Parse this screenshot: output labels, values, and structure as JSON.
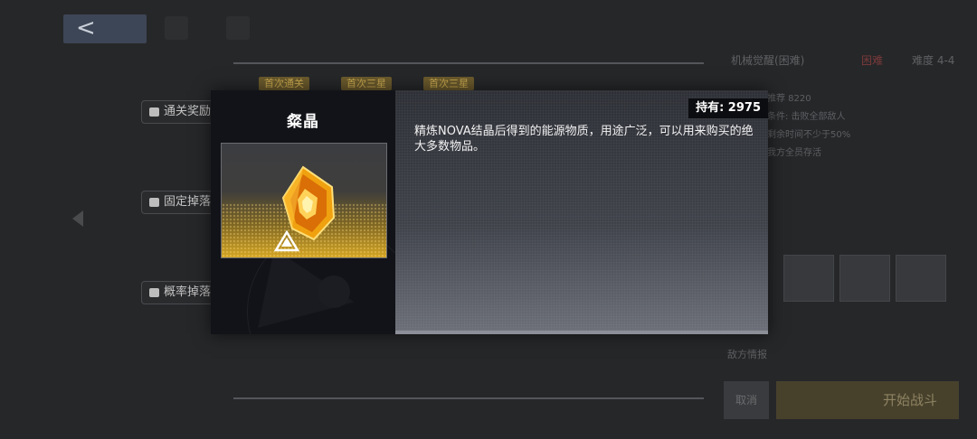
{
  "background": {
    "back_glyph": "<",
    "top_icons": [
      "home-icon",
      "help-icon"
    ],
    "badges": [
      "首次通关",
      "首次三星",
      "首次三星"
    ],
    "side_labels": [
      "通关奖励",
      "固定掉落",
      "概率掉落"
    ],
    "right_tabs": [
      "机械觉醒(困难)",
      "困难",
      "难度 4-4"
    ],
    "right_info": [
      "推荐 8220",
      "条件: 击败全部敌人",
      "剩余时间不少于50%",
      "我方全员存活"
    ],
    "bottom_tag": "敌方情报",
    "cancel_label": "取消",
    "start_label": "开始战斗"
  },
  "modal": {
    "item_name": "粲晶",
    "hold_label": "持有: 2975",
    "description": "精炼NOVA结晶后得到的能源物质，用途广泛，可以用来购买的绝大多数物品。"
  },
  "colors": {
    "accent_gold": "#d4a524",
    "modal_dark": "#121318",
    "badge_bg": "#6b5a2c"
  }
}
